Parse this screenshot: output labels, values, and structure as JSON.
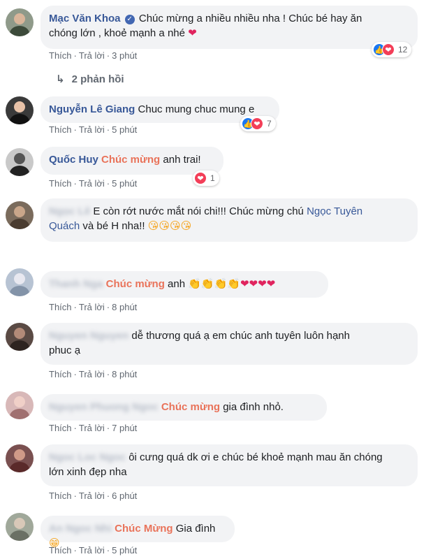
{
  "actions": {
    "like": "Thích",
    "reply": "Trả lời"
  },
  "comments": [
    {
      "name": "Mạc Văn Khoa",
      "text1": "Chúc mừng a nhiều nhiều nha ! Chúc bé hay ăn",
      "text2": "chóng lớn , khoẻ mạnh a nhé ",
      "emoji": "❤",
      "time": "3 phút",
      "reaction_count": "12"
    },
    {
      "name": "Nguyễn Lê Giang",
      "text": "Chuc mung chuc mung e",
      "time": "5 phút",
      "reaction_count": "7"
    },
    {
      "name": "Quốc Huy",
      "tag": "Chúc mừng",
      "text": " anh trai!",
      "time": "5 phút",
      "reaction_count": "1"
    },
    {
      "name": "Ngọc Lê",
      "text1": "E còn rớt nước mắt nói chi!!! Chúc mừng chú ",
      "link": "Ngọc Tuyên",
      "link2": "Quách",
      "text2": " và bé H nha!! ",
      "emoji": "😘😘😘😘"
    },
    {
      "name": "Thanh Nga",
      "tag": "Chúc mừng",
      "text": " anh ",
      "emoji_claps": "👏👏👏👏",
      "emoji_hearts": "❤❤❤❤",
      "time": "8 phút"
    },
    {
      "name": "Nguyen Nguyen",
      "text1": " dễ thương quá ạ em chúc anh tuyên luôn hạnh",
      "text2": "phuc ạ",
      "time": "8 phút"
    },
    {
      "name": "Nguyen Phuong Ngoc",
      "tag": "Chúc mừng",
      "text": " gia đình nhỏ.",
      "time": "7 phút"
    },
    {
      "name": "Ngoc Loc Ngoc",
      "text1": "ôi cưng quá dk ơi e chúc bé khoẻ mạnh mau ăn chóng",
      "text2": "lớn xinh đẹp nha",
      "time": "6 phút"
    },
    {
      "name": "An Ngoc Nhi",
      "tag": "Chúc Mừng",
      "text": " Gia đình ",
      "emoji": "😁",
      "time": "5 phút"
    }
  ],
  "replies_label": "2 phản hồi",
  "colors": {
    "name": "#385898",
    "tag": "#e9735a",
    "bubble": "#f2f3f5",
    "meta": "#606770"
  },
  "icons": {
    "like": "like-icon",
    "love": "love-icon",
    "reply_arrow": "reply-arrow-icon"
  }
}
